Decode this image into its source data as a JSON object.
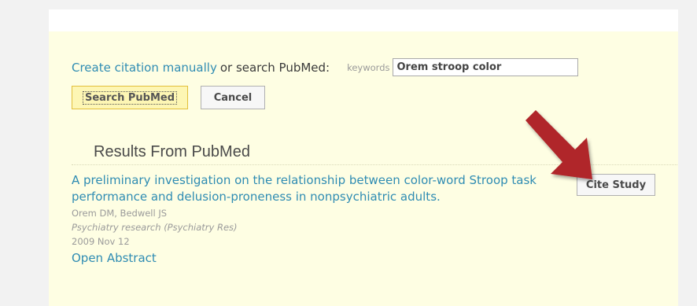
{
  "search_row": {
    "create_link": "Create citation manually",
    "or_text": "or search PubMed:",
    "keywords_label": "keywords",
    "keywords_value": "Orem stroop color"
  },
  "buttons": {
    "search": "Search PubMed",
    "cancel": "Cancel",
    "cite": "Cite Study"
  },
  "results": {
    "heading": "Results From PubMed",
    "items": [
      {
        "title": "A preliminary investigation on the relationship between color-word Stroop task performance and delusion-proneness in nonpsychiatric adults.",
        "authors": "Orem DM, Bedwell JS",
        "journal": "Psychiatry research (Psychiatry Res)",
        "date": "2009 Nov 12",
        "open_abstract": "Open Abstract"
      }
    ]
  },
  "colors": {
    "link": "#2f8cb3",
    "panel": "#fefee3",
    "arrow": "#b0262c"
  },
  "icons": {
    "pointer": "arrow-pointer-icon"
  }
}
